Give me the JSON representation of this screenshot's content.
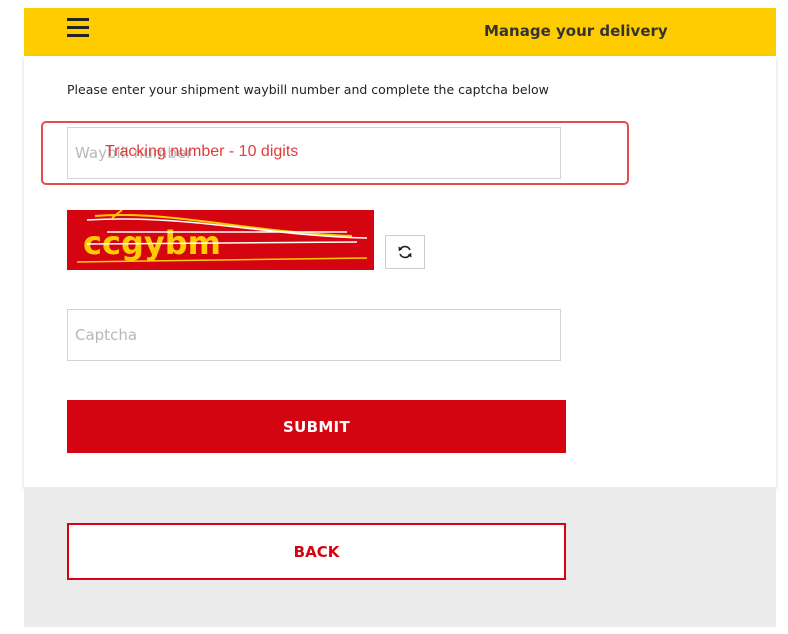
{
  "header": {
    "title": "Manage your delivery",
    "menu_icon": "hamburger-menu-icon"
  },
  "form": {
    "instructions": "Please enter your shipment waybill number and complete the captcha below",
    "waybill_placeholder": "Waybill number",
    "annotation": "Tracking number - 10 digits",
    "captcha_text": "ccgybm",
    "refresh_icon": "refresh-icon",
    "captcha_placeholder": "Captcha",
    "submit_label": "SUBMIT"
  },
  "footer": {
    "back_label": "BACK"
  },
  "colors": {
    "brand_yellow": "#ffcc00",
    "brand_red": "#d40511",
    "annotation_red": "#e74c4c"
  }
}
